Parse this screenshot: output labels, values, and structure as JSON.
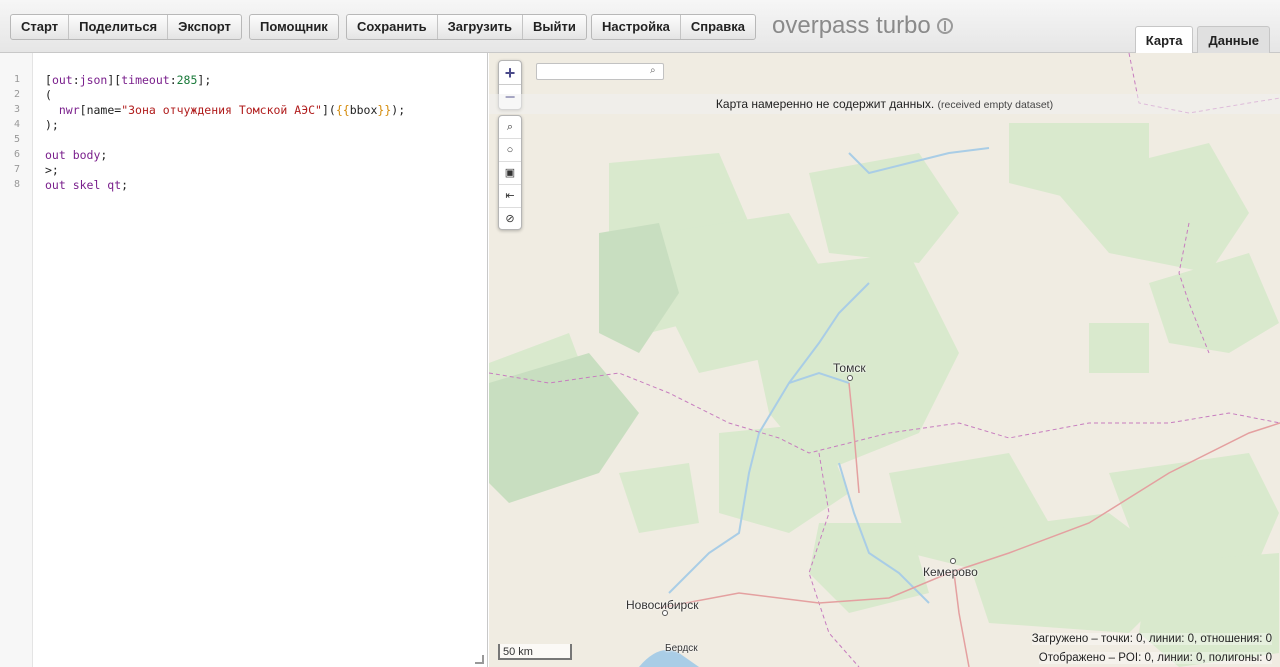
{
  "toolbar": {
    "group1": [
      "Старт",
      "Поделиться",
      "Экспорт"
    ],
    "group2": [
      "Помощник"
    ],
    "group3": [
      "Сохранить",
      "Загрузить",
      "Выйти"
    ],
    "group4": [
      "Настройка",
      "Справка"
    ],
    "logo": "overpass turbo"
  },
  "tabs": {
    "map": "Карта",
    "data": "Данные"
  },
  "editor": {
    "line_numbers": [
      "1",
      "2",
      "3",
      "4",
      "5",
      "6",
      "7",
      "8"
    ]
  },
  "map": {
    "zoom_in": "+",
    "zoom_out": "−",
    "tools": [
      "⌕",
      "○",
      "▣",
      "⇤",
      "⊘"
    ],
    "search_placeholder": "",
    "notice_main": "Карта намеренно не содержит данных.",
    "notice_small": "(received empty dataset)",
    "cities": {
      "tomsk": "Томск",
      "kemerovo": "Кемерово",
      "novosibirsk": "Новосибирск",
      "berdsk": "Бердск"
    },
    "scale": "50 km",
    "stats_loaded": "Загружено – точки: 0, линии: 0, отношения: 0",
    "stats_displayed": "Отображено – POI: 0, линии: 0, полигоны: 0"
  },
  "colors": {
    "map_bg": "#f0ece2",
    "forest": "#d9e9cd",
    "water": "#a9cde6",
    "border": "#c77dbf",
    "road": "#e4a0a0"
  }
}
